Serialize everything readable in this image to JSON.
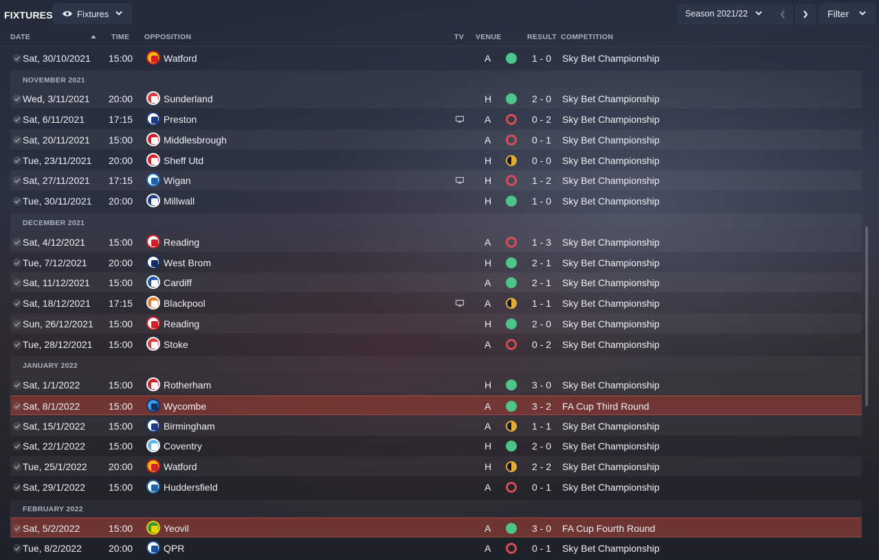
{
  "header": {
    "title": "FIXTURES",
    "view_label": "Fixtures",
    "season_label": "Season 2021/22",
    "filter_label": "Filter"
  },
  "columns": {
    "date": "DATE",
    "time": "TIME",
    "opposition": "OPPOSITION",
    "tv": "TV",
    "venue": "VENUE",
    "result": "RESULT",
    "competition": "COMPETITION"
  },
  "icons": {
    "view": "eye-icon",
    "dropdown": "chevron-down-icon",
    "prev": "chevron-left-icon",
    "next": "chevron-right-icon",
    "played": "check-icon",
    "tv": "tv-icon"
  },
  "colors": {
    "win": "#4cc48a",
    "loss": "#d94b55",
    "draw": "#e4ad38",
    "cup_row": "#843a34"
  },
  "sections": [
    "NOVEMBER 2021",
    "DECEMBER 2021",
    "JANUARY 2022",
    "FEBRUARY 2022"
  ],
  "fixtures": [
    {
      "date": "Sat, 30/10/2021",
      "time": "15:00",
      "opposition": "Watford",
      "tv": false,
      "venue": "A",
      "outcome": "win",
      "score": "1 - 0",
      "competition": "Sky Bet Championship",
      "crest_color": "#f0c000",
      "crest_accent": "#d0202a"
    },
    {
      "date": "Wed, 3/11/2021",
      "time": "20:00",
      "opposition": "Sunderland",
      "tv": false,
      "venue": "H",
      "outcome": "win",
      "score": "2 - 0",
      "competition": "Sky Bet Championship",
      "crest_color": "#e03a3e",
      "crest_accent": "#ffffff"
    },
    {
      "date": "Sat, 6/11/2021",
      "time": "17:15",
      "opposition": "Preston",
      "tv": true,
      "venue": "A",
      "outcome": "loss",
      "score": "0 - 2",
      "competition": "Sky Bet Championship",
      "crest_color": "#ffffff",
      "crest_accent": "#1b3b8a"
    },
    {
      "date": "Sat, 20/11/2021",
      "time": "15:00",
      "opposition": "Middlesbrough",
      "tv": false,
      "venue": "A",
      "outcome": "loss",
      "score": "0 - 1",
      "competition": "Sky Bet Championship",
      "crest_color": "#d0202a",
      "crest_accent": "#ffffff"
    },
    {
      "date": "Tue, 23/11/2021",
      "time": "20:00",
      "opposition": "Sheff Utd",
      "tv": false,
      "venue": "H",
      "outcome": "draw",
      "score": "0 - 0",
      "competition": "Sky Bet Championship",
      "crest_color": "#e02020",
      "crest_accent": "#ffffff"
    },
    {
      "date": "Sat, 27/11/2021",
      "time": "17:15",
      "opposition": "Wigan",
      "tv": true,
      "venue": "H",
      "outcome": "loss",
      "score": "1 - 2",
      "competition": "Sky Bet Championship",
      "crest_color": "#ffffff",
      "crest_accent": "#1c64b0"
    },
    {
      "date": "Tue, 30/11/2021",
      "time": "20:00",
      "opposition": "Millwall",
      "tv": false,
      "venue": "H",
      "outcome": "win",
      "score": "1 - 0",
      "competition": "Sky Bet Championship",
      "crest_color": "#1c3f94",
      "crest_accent": "#ffffff"
    },
    {
      "date": "Sat, 4/12/2021",
      "time": "15:00",
      "opposition": "Reading",
      "tv": false,
      "venue": "A",
      "outcome": "loss",
      "score": "1 - 3",
      "competition": "Sky Bet Championship",
      "crest_color": "#ffffff",
      "crest_accent": "#d0202a"
    },
    {
      "date": "Tue, 7/12/2021",
      "time": "20:00",
      "opposition": "West Brom",
      "tv": false,
      "venue": "H",
      "outcome": "win",
      "score": "2 - 1",
      "competition": "Sky Bet Championship",
      "crest_color": "#ffffff",
      "crest_accent": "#122f67"
    },
    {
      "date": "Sat, 11/12/2021",
      "time": "15:00",
      "opposition": "Cardiff",
      "tv": false,
      "venue": "A",
      "outcome": "win",
      "score": "2 - 1",
      "competition": "Sky Bet Championship",
      "crest_color": "#1b58a8",
      "crest_accent": "#ffffff"
    },
    {
      "date": "Sat, 18/12/2021",
      "time": "17:15",
      "opposition": "Blackpool",
      "tv": true,
      "venue": "A",
      "outcome": "draw",
      "score": "1 - 1",
      "competition": "Sky Bet Championship",
      "crest_color": "#e08030",
      "crest_accent": "#ffffff"
    },
    {
      "date": "Sun, 26/12/2021",
      "time": "15:00",
      "opposition": "Reading",
      "tv": false,
      "venue": "H",
      "outcome": "win",
      "score": "2 - 0",
      "competition": "Sky Bet Championship",
      "crest_color": "#ffffff",
      "crest_accent": "#d0202a"
    },
    {
      "date": "Tue, 28/12/2021",
      "time": "15:00",
      "opposition": "Stoke",
      "tv": false,
      "venue": "A",
      "outcome": "loss",
      "score": "0 - 2",
      "competition": "Sky Bet Championship",
      "crest_color": "#e03a3e",
      "crest_accent": "#ffffff"
    },
    {
      "date": "Sat, 1/1/2022",
      "time": "15:00",
      "opposition": "Rotherham",
      "tv": false,
      "venue": "H",
      "outcome": "win",
      "score": "3 - 0",
      "competition": "Sky Bet Championship",
      "crest_color": "#d0202a",
      "crest_accent": "#ffffff"
    },
    {
      "date": "Sat, 8/1/2022",
      "time": "15:00",
      "opposition": "Wycombe",
      "tv": false,
      "venue": "A",
      "outcome": "win",
      "score": "3 - 2",
      "competition": "FA Cup Third Round",
      "crest_color": "#3aa0e0",
      "crest_accent": "#122f67",
      "cup": true
    },
    {
      "date": "Sat, 15/1/2022",
      "time": "15:00",
      "opposition": "Birmingham",
      "tv": false,
      "venue": "A",
      "outcome": "draw",
      "score": "1 - 1",
      "competition": "Sky Bet Championship",
      "crest_color": "#ffffff",
      "crest_accent": "#1b3b8a"
    },
    {
      "date": "Sat, 22/1/2022",
      "time": "15:00",
      "opposition": "Coventry",
      "tv": false,
      "venue": "H",
      "outcome": "win",
      "score": "2 - 0",
      "competition": "Sky Bet Championship",
      "crest_color": "#5ab8e8",
      "crest_accent": "#ffffff"
    },
    {
      "date": "Tue, 25/1/2022",
      "time": "20:00",
      "opposition": "Watford",
      "tv": false,
      "venue": "H",
      "outcome": "draw",
      "score": "2 - 2",
      "competition": "Sky Bet Championship",
      "crest_color": "#f0c000",
      "crest_accent": "#d0202a"
    },
    {
      "date": "Sat, 29/1/2022",
      "time": "15:00",
      "opposition": "Huddersfield",
      "tv": false,
      "venue": "A",
      "outcome": "loss",
      "score": "0 - 1",
      "competition": "Sky Bet Championship",
      "crest_color": "#ffffff",
      "crest_accent": "#1c64b0"
    },
    {
      "date": "Sat, 5/2/2022",
      "time": "15:00",
      "opposition": "Yeovil",
      "tv": false,
      "venue": "A",
      "outcome": "win",
      "score": "3 - 0",
      "competition": "FA Cup Fourth Round",
      "crest_color": "#2e9a3a",
      "crest_accent": "#f0d000",
      "cup": true
    },
    {
      "date": "Tue, 8/2/2022",
      "time": "20:00",
      "opposition": "QPR",
      "tv": false,
      "venue": "A",
      "outcome": "loss",
      "score": "0 - 1",
      "competition": "Sky Bet Championship",
      "crest_color": "#ffffff",
      "crest_accent": "#1c4fa0"
    }
  ]
}
